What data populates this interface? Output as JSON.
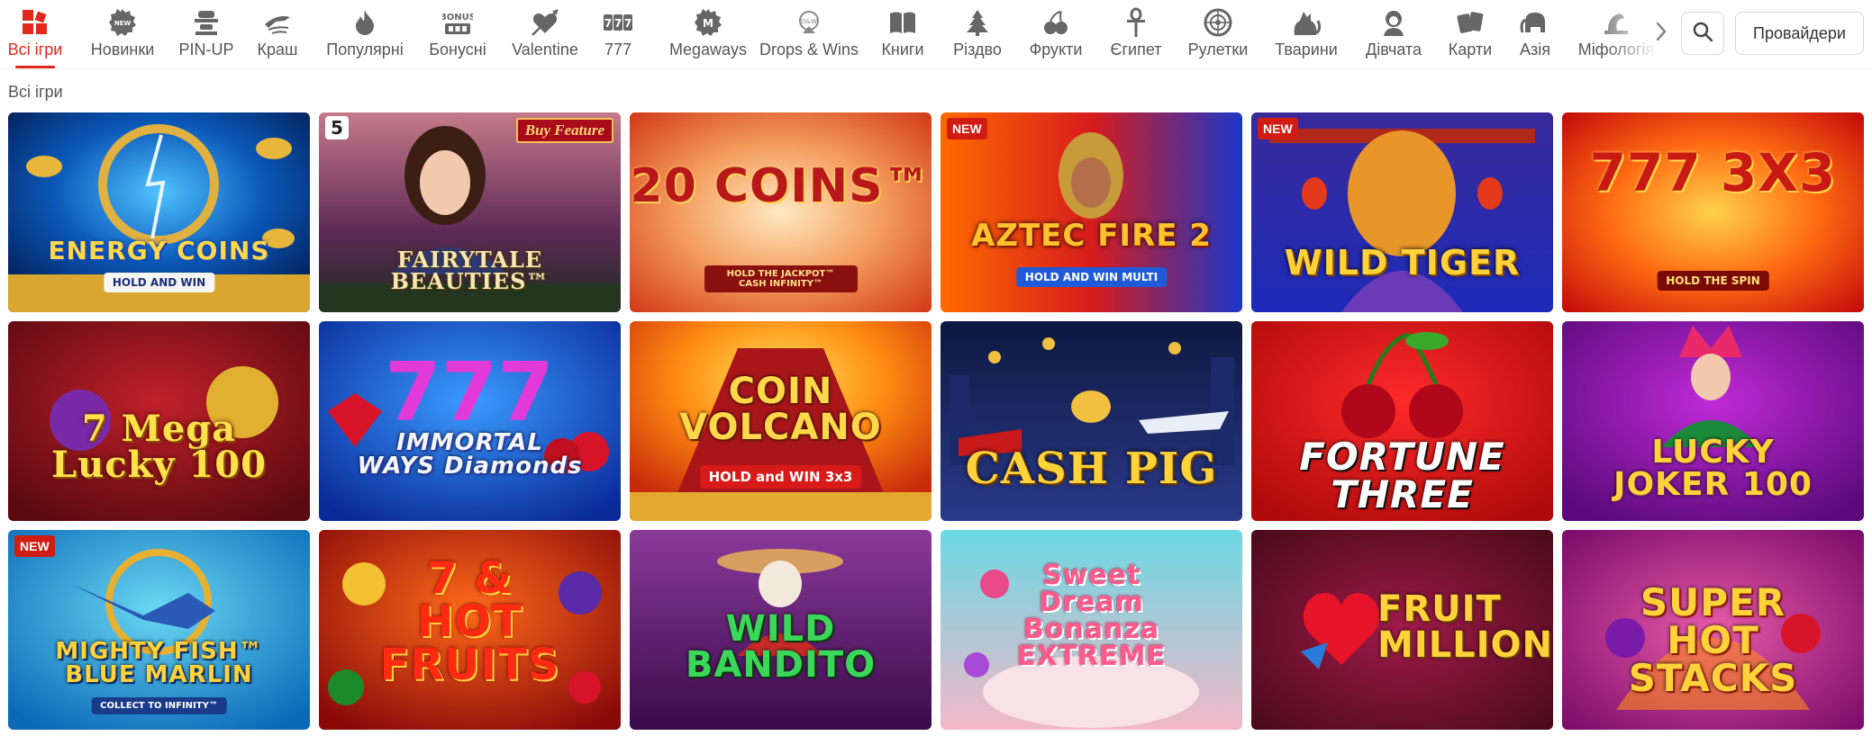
{
  "categories": [
    {
      "label": "Всі ігри",
      "icon": "all-games-grid-icon",
      "active": true
    },
    {
      "label": "Новинки",
      "icon": "new-badge-icon"
    },
    {
      "label": "PIN-UP",
      "icon": "pinup-girl-icon"
    },
    {
      "label": "Краш",
      "icon": "plane-crash-icon"
    },
    {
      "label": "Популярні",
      "icon": "flame-icon"
    },
    {
      "label": "Бонусні",
      "icon": "bonus-icon"
    },
    {
      "label": "Valentine",
      "icon": "heart-arrow-icon"
    },
    {
      "label": "777",
      "icon": "sevens-icon"
    },
    {
      "label": "Megaways",
      "icon": "megaways-icon"
    },
    {
      "label": "Drops & Wins",
      "icon": "drops-wins-icon"
    },
    {
      "label": "Книги",
      "icon": "book-icon"
    },
    {
      "label": "Різдво",
      "icon": "christmas-tree-icon"
    },
    {
      "label": "Фрукти",
      "icon": "fruits-icon"
    },
    {
      "label": "Єгипет",
      "icon": "ankh-icon"
    },
    {
      "label": "Рулетки",
      "icon": "roulette-icon"
    },
    {
      "label": "Тварини",
      "icon": "cat-icon"
    },
    {
      "label": "Дівчата",
      "icon": "girl-icon"
    },
    {
      "label": "Карти",
      "icon": "cards-icon"
    },
    {
      "label": "Азія",
      "icon": "elephant-icon"
    },
    {
      "label": "Міфологія",
      "icon": "mythology-icon"
    }
  ],
  "header": {
    "providers_label": "Провайдери",
    "search_icon": "search-icon",
    "scroll_icon": "chevron-right-icon"
  },
  "section_title": "Всі ігри",
  "badge_new_label": "NEW",
  "colors": {
    "accent": "#e2281d",
    "badge_new": "#d01c12"
  },
  "games": [
    {
      "title": "ENERGY COINS",
      "subtitle": "HOLD AND WIN",
      "theme": "blue-gold"
    },
    {
      "title": "FAIRYTALE BEAUTIES™",
      "subtitle": "",
      "corner_badge": "Buy Feature",
      "number_badge": "5",
      "theme": "fairy"
    },
    {
      "title": "20 COINS™",
      "subtitle": "HOLD THE JACKPOT™ CASH INFINITY™",
      "theme": "peach"
    },
    {
      "title": "AZTEC FIRE 2",
      "subtitle": "HOLD AND WIN MULTI",
      "new": true,
      "theme": "fire-blue"
    },
    {
      "title": "WILD TIGER",
      "subtitle": "",
      "new": true,
      "theme": "blue-tiger"
    },
    {
      "title": "777 3X3",
      "subtitle": "HOLD THE SPIN",
      "theme": "fire"
    },
    {
      "title": "7 Mega Lucky 100",
      "subtitle": "",
      "theme": "red-gold"
    },
    {
      "title": "IMMORTAL WAYS Diamonds",
      "subtitle": "",
      "theme": "blue-diamond"
    },
    {
      "title": "COIN VOLCANO",
      "subtitle": "HOLD and WIN 3x3",
      "theme": "volcano"
    },
    {
      "title": "CASH PIG",
      "subtitle": "",
      "theme": "night-city"
    },
    {
      "title": "FORTUNE THREE",
      "subtitle": "",
      "theme": "red-cherry"
    },
    {
      "title": "LUCKY JOKER 100",
      "subtitle": "",
      "theme": "purple-joker"
    },
    {
      "title": "MIGHTY FISH™ BLUE MARLIN",
      "subtitle": "COLLECT TO INFINITY™",
      "new": true,
      "theme": "ocean"
    },
    {
      "title": "7 & HOT FRUITS",
      "subtitle": "",
      "theme": "hot-fruits"
    },
    {
      "title": "WILD BANDITO",
      "subtitle": "",
      "theme": "bandito"
    },
    {
      "title": "Sweet Dream Bonanza EXTREME",
      "subtitle": "",
      "theme": "candy"
    },
    {
      "title": "FRUIT MILLION",
      "subtitle": "",
      "theme": "hearts"
    },
    {
      "title": "SUPER HOT STACKS",
      "subtitle": "",
      "theme": "purple-fire"
    }
  ]
}
